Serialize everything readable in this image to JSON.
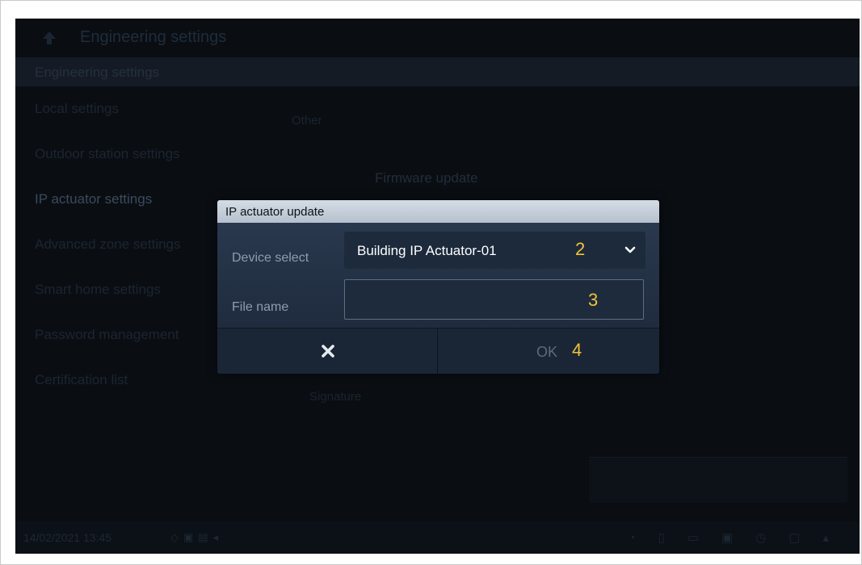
{
  "app": {
    "title": "Engineering settings",
    "section": "Engineering settings"
  },
  "menu": {
    "items": [
      {
        "label": "Local settings"
      },
      {
        "label": "Outdoor station settings"
      },
      {
        "label": "IP actuator settings"
      },
      {
        "label": "Advanced zone settings"
      },
      {
        "label": "Smart home settings"
      },
      {
        "label": "Password management"
      },
      {
        "label": "Certification list"
      }
    ],
    "active_index": 2
  },
  "background": {
    "other_label": "Other",
    "firmware_label": "Firmware update",
    "signature_label": "Signature"
  },
  "status": {
    "datetime": "14/02/2021 13:45"
  },
  "dialog": {
    "title": "IP actuator update",
    "device_select_label": "Device select",
    "device_selected": "Building IP Actuator-01",
    "file_name_label": "File name",
    "file_name_value": "",
    "ok_label": "OK",
    "markers": {
      "select": "2",
      "file": "3",
      "ok": "4"
    }
  },
  "colors": {
    "marker": "#f0c23a",
    "dialog_header": "#c4cdd7"
  },
  "icons": {
    "back": "back-arrow-icon",
    "chevron": "chevron-down-icon",
    "cancel": "close-icon"
  }
}
